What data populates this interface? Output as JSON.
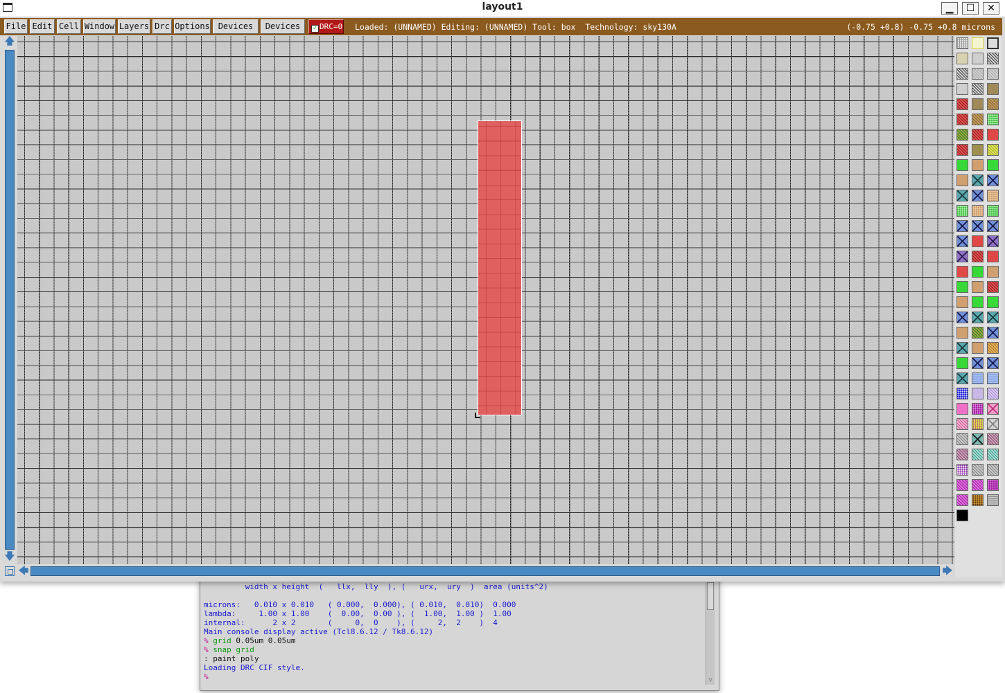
{
  "window": {
    "title": "layout1",
    "minimize_glyph": "▁",
    "maximize_glyph": "☐",
    "close_glyph": "✕"
  },
  "menu": {
    "items": [
      "File",
      "Edit",
      "Cell",
      "Window",
      "Layers",
      "Drc",
      "Options",
      "Devices 1",
      "Devices 2"
    ],
    "drc_label": "DRC=0",
    "drc_checked": true
  },
  "status": {
    "text": "Loaded: (UNNAMED) Editing: (UNNAMED) Tool: box  Technology: sky130A",
    "coords": "(-0.75 +0.8) -0.75 +0.8 microns"
  },
  "layout": {
    "shape": {
      "layer": "poly",
      "color": "#e06060"
    }
  },
  "palette": {
    "swatches": [
      [
        "grid-gray",
        "yellow-outline",
        "dark-outline"
      ],
      [
        "tan-light",
        "gray-plain",
        "hatch-dark"
      ],
      [
        "hatch-dark",
        "hatch-light",
        "hatch-light"
      ],
      [
        "gray-plain",
        "hatch-dark",
        "brown"
      ],
      [
        "red-hatch",
        "brown",
        "brown-hatch"
      ],
      [
        "red-hatch",
        "brown-hatch",
        "green-dots"
      ],
      [
        "green-hatch",
        "red-hatch",
        "red"
      ],
      [
        "red-hatch",
        "olive",
        "yellow-green-hatch"
      ],
      [
        "green",
        "tan",
        "green"
      ],
      [
        "tan",
        "teal-x",
        "blue-x"
      ],
      [
        "teal-x",
        "blue-x",
        "tan-dots"
      ],
      [
        "green-dots",
        "tan-dots",
        "green-dots"
      ],
      [
        "blue-x",
        "blue-x",
        "blue-x"
      ],
      [
        "blue-x",
        "red",
        "purple-x"
      ],
      [
        "purple-x",
        "red-hatch",
        "red"
      ],
      [
        "red",
        "green",
        "tan"
      ],
      [
        "green",
        "tan",
        "red-hatch"
      ],
      [
        "tan",
        "green",
        "green"
      ],
      [
        "blue-x",
        "teal-x",
        "teal-x"
      ],
      [
        "tan",
        "green-hatch",
        "blue-x"
      ],
      [
        "teal-x",
        "tan",
        "orange-hatch"
      ],
      [
        "green",
        "blue-x",
        "blue-x"
      ],
      [
        "teal-x",
        "blue-light",
        "blue-light"
      ],
      [
        "blue-check",
        "lavender",
        "lavender-hatch"
      ],
      [
        "pink",
        "magenta-check",
        "pink-x"
      ],
      [
        "pink-hatch",
        "yellow-check",
        "gray-x"
      ],
      [
        "gray-hatch",
        "teal-x2",
        "mauve-hatch"
      ],
      [
        "mauve-hatch",
        "teal-hatch",
        "teal-hatch"
      ],
      [
        "purple-dots",
        "gray-hatch",
        "gray-hatch"
      ],
      [
        "magenta-hatch",
        "magenta-hatch",
        "magenta-check"
      ],
      [
        "magenta-hatch",
        "gold-check",
        "gray-lines"
      ],
      [
        "black"
      ]
    ]
  },
  "console": {
    "lines": [
      {
        "cls": "c-out",
        "text": "         width x height  (   llx,  lly  ), (   urx,  ury  )  area (units^2)"
      },
      {
        "cls": "c-out",
        "text": ""
      },
      {
        "cls": "c-out",
        "text": "microns:   0.010 x 0.010   ( 0.000,  0.000), ( 0.010,  0.010)  0.000"
      },
      {
        "cls": "c-out",
        "text": "lambda:     1.00 x 1.00    (  0.00,  0.00 ), (  1.00,  1.00 )  1.00"
      },
      {
        "cls": "c-out",
        "text": "internal:      2 x 2       (     0,  0    ), (     2,  2    )  4"
      },
      {
        "cls": "c-out",
        "text": "Main console display active (Tcl8.6.12 / Tk8.6.12)"
      },
      {
        "cls": "c-mixed",
        "prompt": "% ",
        "cmd": "grid",
        "rest": " 0.05um 0.05um"
      },
      {
        "cls": "c-mixed",
        "prompt": "% ",
        "cmd": "snap grid",
        "rest": ""
      },
      {
        "cls": "c-mixed2",
        "prompt": ": ",
        "cmd": "",
        "rest": "paint poly"
      },
      {
        "cls": "c-out",
        "text": "Loading DRC CIF style."
      },
      {
        "cls": "c-mixed",
        "prompt": "%",
        "cmd": "",
        "rest": ""
      }
    ]
  }
}
